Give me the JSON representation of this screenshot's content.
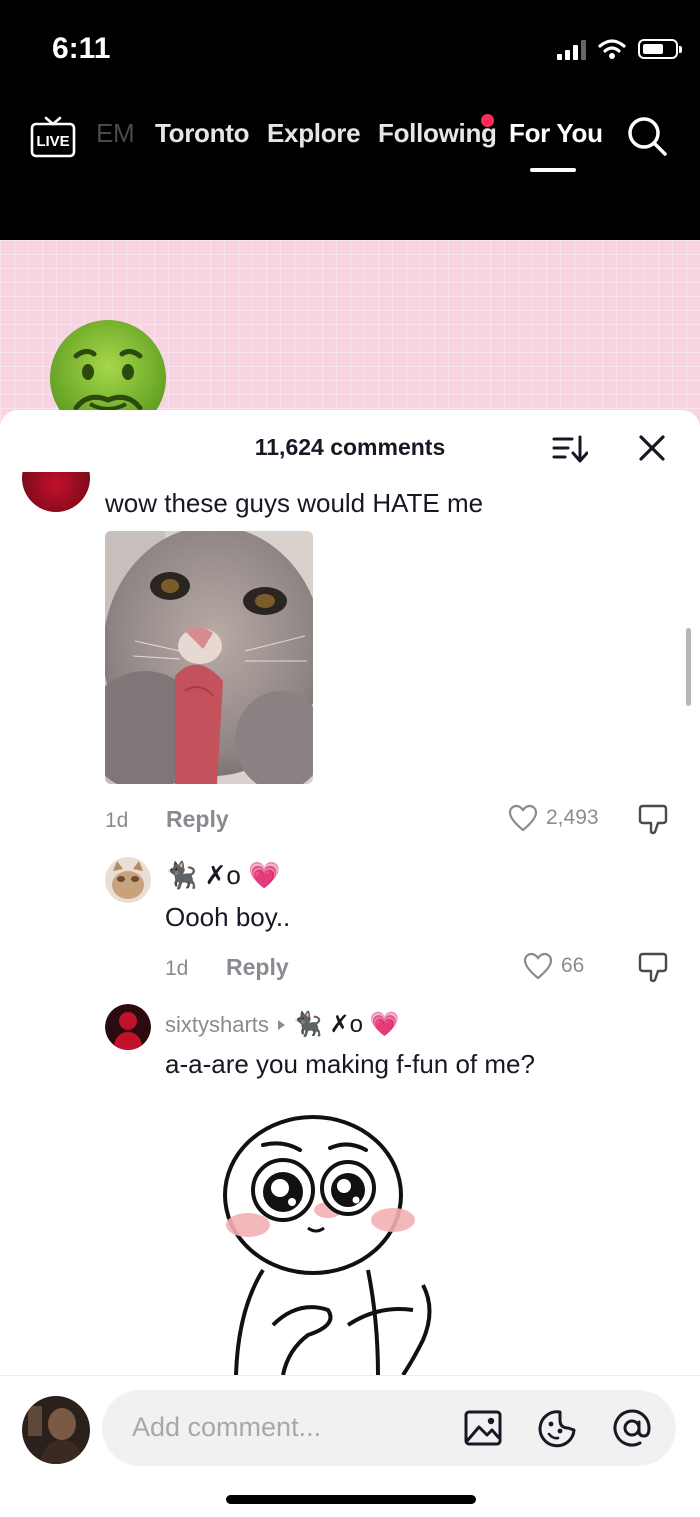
{
  "status_bar": {
    "time": "6:11"
  },
  "nav": {
    "live_label": "LIVE",
    "items": [
      "EM",
      "Toronto",
      "Explore",
      "Following",
      "For You"
    ]
  },
  "comments_sheet": {
    "count_label": "11,624 comments",
    "comments": [
      {
        "text": "wow these guys would HATE me",
        "age": "1d",
        "reply_label": "Reply",
        "likes": "2,493",
        "replies": [
          {
            "username_emoji": "🐈‍⬛ ✗o 💗",
            "text": "Oooh boy..",
            "age": "1d",
            "reply_label": "Reply",
            "likes": "66"
          },
          {
            "username": "sixtysharts",
            "reply_to": "🐈‍⬛ ✗o 💗",
            "text": "a-a-are you making f-fun of me?"
          }
        ]
      }
    ]
  },
  "composer": {
    "placeholder": "Add comment..."
  },
  "colors": {
    "accent": "#fe2c55",
    "pink_bg": "#f8d3e2",
    "text": "#161823",
    "muted": "#8a8b91"
  }
}
